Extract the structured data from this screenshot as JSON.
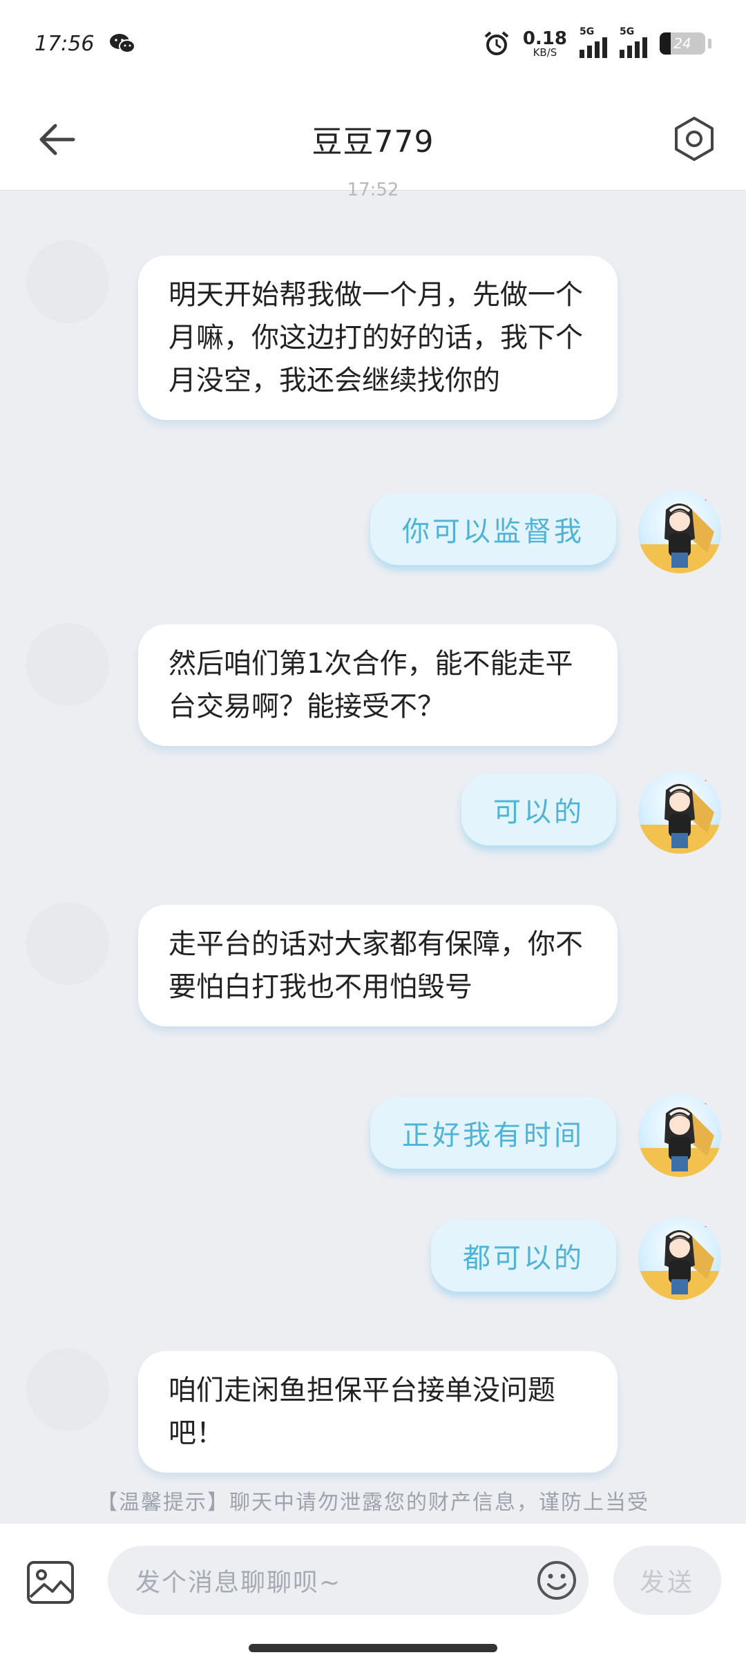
{
  "status_bar": {
    "time": "17:56",
    "net_speed_value": "0.18",
    "net_speed_unit": "KB/S",
    "network_1": "5G",
    "network_2": "5G",
    "battery_level": "24",
    "battery_fraction": 0.24
  },
  "header": {
    "title": "豆豆779",
    "back_icon": "arrow-left-icon",
    "settings_icon": "hexagon-gear-icon"
  },
  "chat": {
    "timestamp": "17:52",
    "messages": [
      {
        "side": "in",
        "text": "明天开始帮我做一个月，先做一个月嘛，你这边打的好的话，我下个月没空，我还会继续找你的"
      },
      {
        "side": "out",
        "text": "你可以监督我"
      },
      {
        "side": "in",
        "text": "然后咱们第1次合作，能不能走平台交易啊？能接受不？"
      },
      {
        "side": "out",
        "text": "可以的"
      },
      {
        "side": "in",
        "text": "走平台的话对大家都有保障，你不要怕白打我也不用怕毁号"
      },
      {
        "side": "out",
        "text": "正好我有时间"
      },
      {
        "side": "out",
        "text": "都可以的"
      },
      {
        "side": "in",
        "text": "咱们走闲鱼担保平台接单没问题吧！"
      }
    ]
  },
  "tip": "【温馨提示】聊天中请勿泄露您的财产信息，谨防上当受",
  "input_bar": {
    "placeholder": "发个消息聊聊呗~",
    "send_label": "发送",
    "image_icon": "image-icon",
    "emoji_icon": "emoji-icon"
  }
}
